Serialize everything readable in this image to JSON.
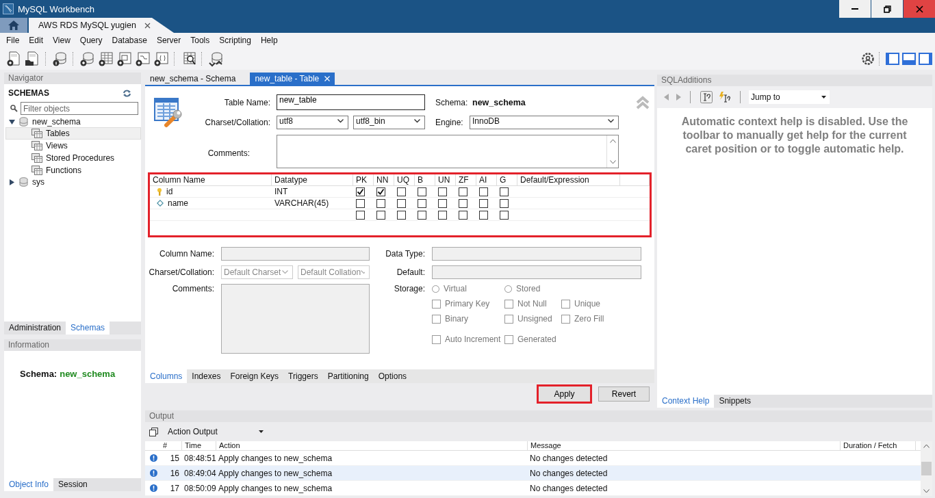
{
  "window": {
    "title": "MySQL Workbench"
  },
  "connection_tabs": [
    {
      "kind": "home",
      "selected": false
    },
    {
      "kind": "connection",
      "label": "AWS RDS MySQL yugien",
      "selected": true
    }
  ],
  "menu": [
    "File",
    "Edit",
    "View",
    "Query",
    "Database",
    "Server",
    "Tools",
    "Scripting",
    "Help"
  ],
  "navigator": {
    "title": "Navigator",
    "heading": "SCHEMAS",
    "filter": {
      "placeholder": "Filter objects"
    },
    "tree": [
      {
        "label": "new_schema",
        "expanded": true,
        "children": [
          {
            "label": "Tables",
            "selected": true
          },
          {
            "label": "Views",
            "selected": false
          },
          {
            "label": "Stored Procedures",
            "selected": false
          },
          {
            "label": "Functions",
            "selected": false
          }
        ]
      },
      {
        "label": "sys",
        "expanded": false
      }
    ],
    "tabs": [
      {
        "label": "Administration",
        "selected": false
      },
      {
        "label": "Schemas",
        "selected": true
      }
    ]
  },
  "information": {
    "title": "Information",
    "label": "Schema:",
    "value": "new_schema",
    "tabs": [
      {
        "label": "Object Info",
        "selected": true
      },
      {
        "label": "Session",
        "selected": false
      }
    ]
  },
  "editor_tabs": [
    {
      "label": "new_schema - Schema",
      "selected": false
    },
    {
      "label": "new_table - Table",
      "selected": true
    }
  ],
  "table_editor": {
    "table_name_label": "Table Name:",
    "table_name": "new_table",
    "schema_label": "Schema:",
    "schema": "new_schema",
    "charset_label": "Charset/Collation:",
    "charset": "utf8",
    "collation": "utf8_bin",
    "engine_label": "Engine:",
    "engine": "InnoDB",
    "comments_label": "Comments:"
  },
  "columns_grid": {
    "highlighted": true,
    "headers": [
      "Column Name",
      "Datatype",
      "PK",
      "NN",
      "UQ",
      "B",
      "UN",
      "ZF",
      "AI",
      "G",
      "Default/Expression"
    ],
    "rows": [
      {
        "kind": "primary_key",
        "name": "id",
        "datatype": "INT",
        "flags": [
          true,
          true,
          false,
          false,
          false,
          false,
          false,
          false
        ]
      },
      {
        "kind": "column",
        "name": "name",
        "datatype": "VARCHAR(45)",
        "flags": [
          false,
          false,
          false,
          false,
          false,
          false,
          false,
          false
        ]
      },
      {
        "kind": "new",
        "flags": [
          false,
          false,
          false,
          false,
          false,
          false,
          false,
          false
        ]
      }
    ]
  },
  "column_details": {
    "disabled": true,
    "column_name_label": "Column Name:",
    "charset_label": "Charset/Collation:",
    "charset": "Default Charset",
    "collation": "Default Collation",
    "comments_label": "Comments:",
    "data_type_label": "Data Type:",
    "default_label": "Default:",
    "storage_label": "Storage:",
    "option_rows": [
      {
        "options": [
          {
            "kind": "radio",
            "label": "Virtual",
            "selected": false
          },
          {
            "kind": "radio",
            "label": "Stored",
            "selected": false
          }
        ]
      },
      {
        "options": [
          {
            "kind": "checkbox",
            "label": "Primary Key",
            "checked": false
          },
          {
            "kind": "checkbox",
            "label": "Not Null",
            "checked": false
          },
          {
            "kind": "checkbox",
            "label": "Unique",
            "checked": false
          }
        ]
      },
      {
        "options": [
          {
            "kind": "checkbox",
            "label": "Binary",
            "checked": false
          },
          {
            "kind": "checkbox",
            "label": "Unsigned",
            "checked": false
          },
          {
            "kind": "checkbox",
            "label": "Zero Fill",
            "checked": false
          }
        ]
      },
      {
        "options": [
          {
            "kind": "checkbox",
            "label": "Auto Increment",
            "checked": false
          },
          {
            "kind": "checkbox",
            "label": "Generated",
            "checked": false
          }
        ]
      }
    ]
  },
  "editor_subtabs": [
    {
      "label": "Columns",
      "selected": true
    },
    {
      "label": "Indexes",
      "selected": false
    },
    {
      "label": "Foreign Keys",
      "selected": false
    },
    {
      "label": "Triggers",
      "selected": false
    },
    {
      "label": "Partitioning",
      "selected": false
    },
    {
      "label": "Options",
      "selected": false
    }
  ],
  "buttons": [
    {
      "label": "Apply",
      "highlighted": true
    },
    {
      "label": "Revert",
      "highlighted": false
    }
  ],
  "sql_additions": {
    "title": "SQLAdditions",
    "jump_to": "Jump to",
    "help_text": "Automatic context help is disabled. Use the toolbar to manually get help for the current caret position or to toggle automatic help.",
    "tabs": [
      {
        "label": "Context Help",
        "selected": true
      },
      {
        "label": "Snippets",
        "selected": false
      }
    ]
  },
  "output": {
    "title": "Output",
    "mode": "Action Output",
    "columns": [
      "#",
      "Time",
      "Action",
      "Message",
      "Duration / Fetch"
    ],
    "rows": [
      {
        "kind": "info",
        "number": "15",
        "time": "08:48:51",
        "action": "Apply changes to new_schema",
        "message": "No changes detected",
        "selected": false
      },
      {
        "kind": "info",
        "number": "16",
        "time": "08:49:04",
        "action": "Apply changes to new_schema",
        "message": "No changes detected",
        "selected": true
      },
      {
        "kind": "info",
        "number": "17",
        "time": "08:50:09",
        "action": "Apply changes to new_schema",
        "message": "No changes detected",
        "selected": false
      }
    ]
  }
}
